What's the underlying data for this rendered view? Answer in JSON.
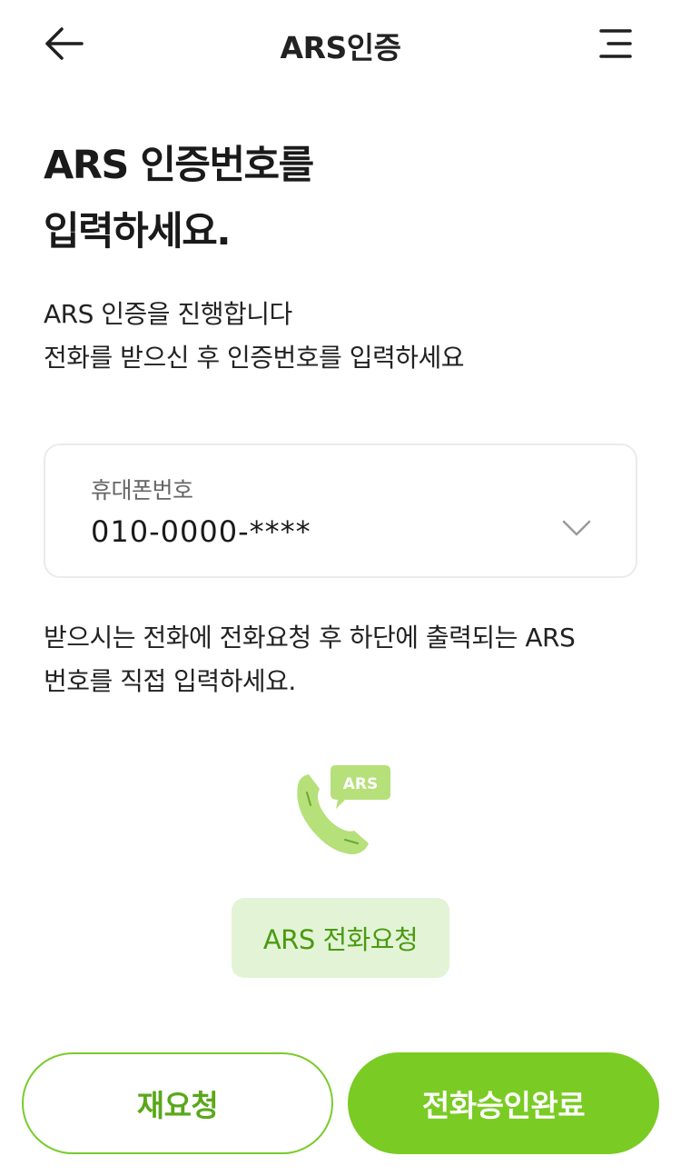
{
  "header": {
    "title": "ARS인증",
    "back_icon": "arrow-left-icon",
    "menu_icon": "menu-icon"
  },
  "headline": {
    "line1": "ARS 인증번호를",
    "line2": "입력하세요."
  },
  "description": {
    "line1": "ARS 인증을 진행합니다",
    "line2": "전화를 받으신 후 인증번호를 입력하세요"
  },
  "phone_field": {
    "label": "휴대폰번호",
    "value": "010-0000-****"
  },
  "instruction": {
    "line1": "받으시는 전화에 전화요청 후 하단에 출력되는 ARS",
    "line2": "번호를 직접 입력하세요."
  },
  "illustration": {
    "bubble_text": "ARS",
    "icon": "phone-ars-icon"
  },
  "ars_request_button": "ARS 전화요청",
  "buttons": {
    "retry": "재요청",
    "complete": "전화승인완료"
  },
  "colors": {
    "primary": "#7acb23",
    "primary_light": "#e3f4d6",
    "primary_text": "#4a9a12",
    "illustration": "#b5e07a"
  }
}
